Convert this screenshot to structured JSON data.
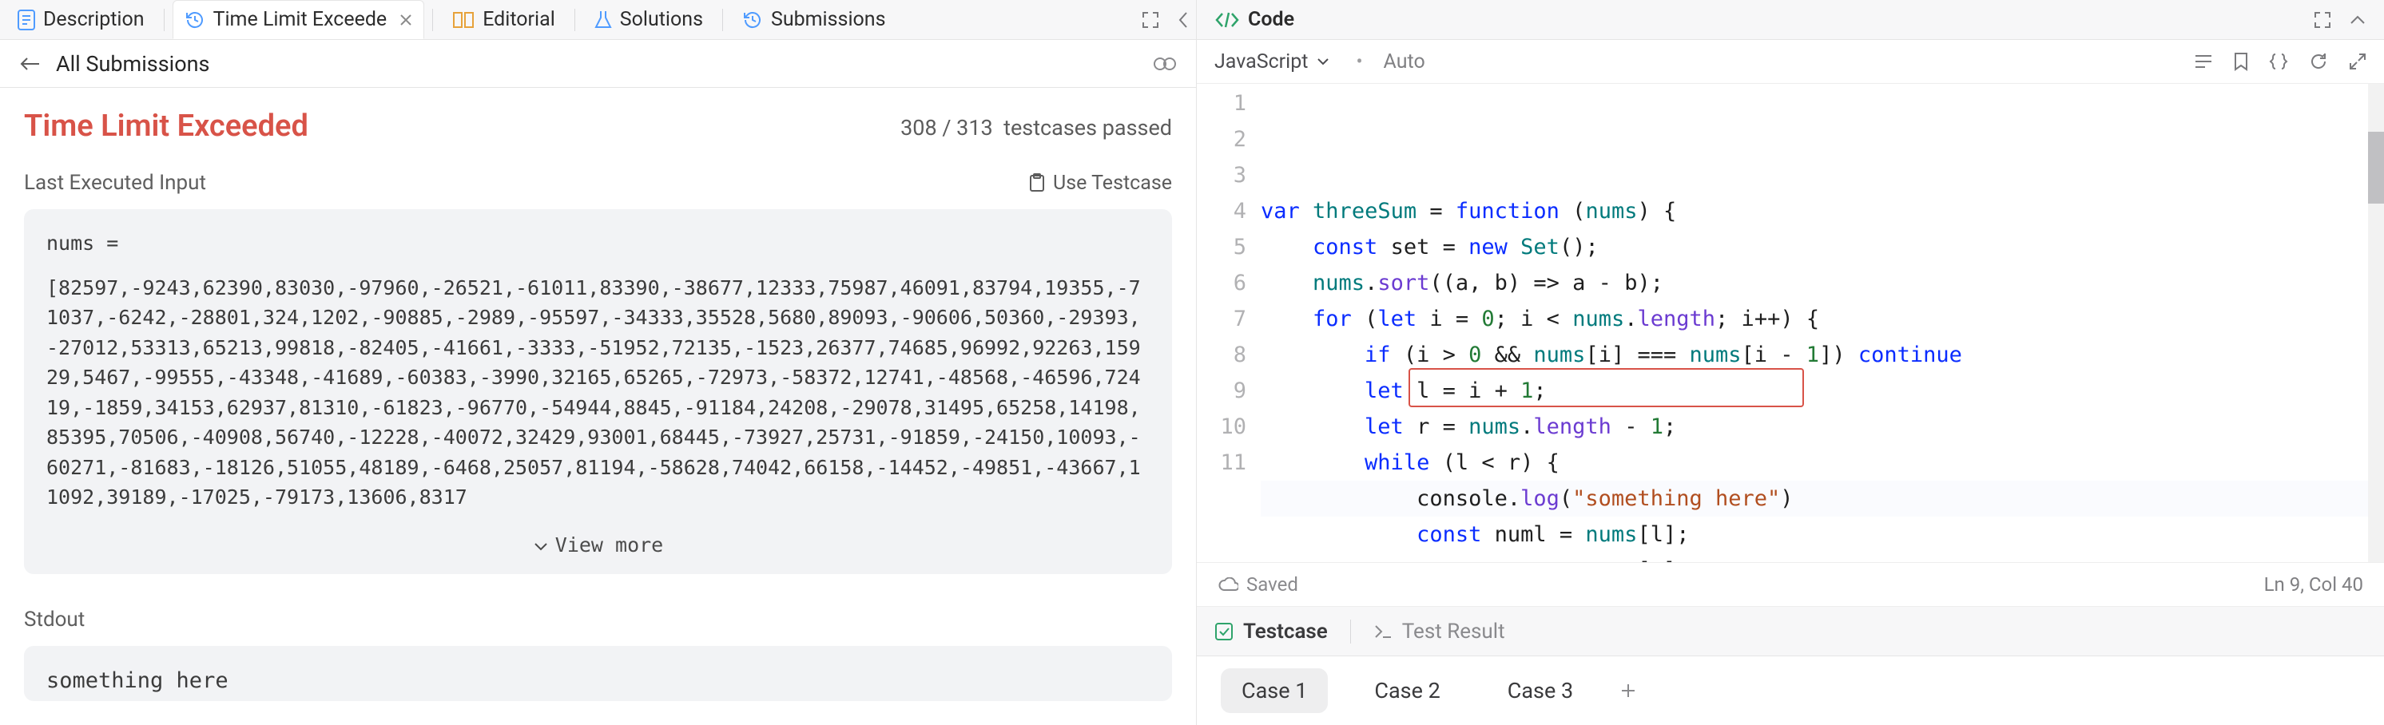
{
  "tabs": {
    "description": "Description",
    "active": "Time Limit Exceede",
    "editorial": "Editorial",
    "solutions": "Solutions",
    "submissions": "Submissions"
  },
  "history": {
    "all_submissions": "All Submissions"
  },
  "result": {
    "title": "Time Limit Exceeded",
    "passed": "308 / 313",
    "passed_suffix": "testcases passed"
  },
  "last_input": {
    "label": "Last Executed Input",
    "use_testcase": "Use Testcase",
    "varname": "nums =",
    "array_text": "[82597,-9243,62390,83030,-97960,-26521,-61011,83390,-38677,12333,75987,46091,83794,19355,-71037,-6242,-28801,324,1202,-90885,-2989,-95597,-34333,35528,5680,89093,-90606,50360,-29393,-27012,53313,65213,99818,-82405,-41661,-3333,-51952,72135,-1523,26377,74685,96992,92263,15929,5467,-99555,-43348,-41689,-60383,-3990,32165,65265,-72973,-58372,12741,-48568,-46596,72419,-1859,34153,62937,81310,-61823,-96770,-54944,8845,-91184,24208,-29078,31495,65258,14198,85395,70506,-40908,56740,-12228,-40072,32429,93001,68445,-73927,25731,-91859,-24150,10093,-60271,-81683,-18126,51055,48189,-6468,25057,81194,-58628,74042,66158,-14452,-49851,-43667,11092,39189,-17025,-79173,13606,8317",
    "view_more": "View more"
  },
  "stdout": {
    "label": "Stdout",
    "value": "something here"
  },
  "code_header": {
    "title": "Code"
  },
  "lang": {
    "name": "JavaScript",
    "auto": "Auto"
  },
  "editor": {
    "lines": [
      "var threeSum = function (nums) {",
      "    const set = new Set();",
      "    nums.sort((a, b) => a - b);",
      "    for (let i = 0; i < nums.length; i++) {",
      "        if (i > 0 && nums[i] === nums[i - 1]) continue",
      "        let l = i + 1;",
      "        let r = nums.length - 1;",
      "        while (l < r) {",
      "            console.log(\"something here\")",
      "            const numl = nums[l];",
      "            const numr = nums[r];"
    ],
    "cursor": "Ln 9, Col 40",
    "saved": "Saved"
  },
  "panel": {
    "testcase": "Testcase",
    "test_result": "Test Result",
    "cases": [
      "Case 1",
      "Case 2",
      "Case 3"
    ]
  }
}
